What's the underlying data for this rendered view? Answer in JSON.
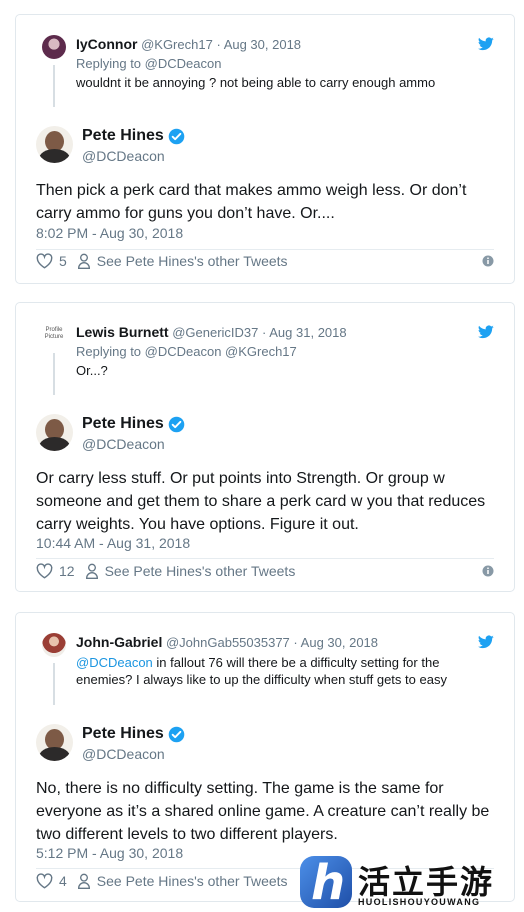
{
  "tweets": [
    {
      "reply": {
        "name": "IyConnor",
        "handle": "@KGrech17",
        "date": "Aug 30, 2018",
        "replying_to": "Replying to @DCDeacon",
        "text": "wouldnt it be annoying ? not being able to carry enough ammo"
      },
      "author": {
        "name": "Pete Hines",
        "handle": "@DCDeacon"
      },
      "text": "Then pick a perk card that makes ammo weigh less. Or don’t carry ammo for guns you don’t have. Or....",
      "timestamp": "8:02 PM - Aug 30, 2018",
      "likes": "5",
      "see_other": "See Pete Hines's other Tweets"
    },
    {
      "reply": {
        "name": "Lewis Burnett",
        "handle": "@GenericID37",
        "date": "Aug 31, 2018",
        "replying_to": "Replying to @DCDeacon @KGrech17",
        "text": "Or...?",
        "avatar_placeholder": "Profile Picture"
      },
      "author": {
        "name": "Pete Hines",
        "handle": "@DCDeacon"
      },
      "text": "Or carry less stuff. Or put points into Strength. Or group w someone and get them to share a perk card w you that reduces carry weights. You have options. Figure it out.",
      "timestamp": "10:44 AM - Aug 31, 2018",
      "likes": "12",
      "see_other": "See Pete Hines's other Tweets"
    },
    {
      "reply": {
        "name": "John-Gabriel",
        "handle": "@JohnGab55035377",
        "date": "Aug 30, 2018",
        "mention": "@DCDeacon",
        "text": " in fallout 76 will there be a difficulty setting for the enemies? I always like to up the difficulty when stuff gets to easy"
      },
      "author": {
        "name": "Pete Hines",
        "handle": "@DCDeacon"
      },
      "text": "No, there is no difficulty setting. The game is the same for everyone as it’s a shared online game. A creature can’t really be two different levels to two different players.",
      "timestamp": "5:12 PM - Aug 30, 2018",
      "likes": "4",
      "see_other": "See Pete Hines's other Tweets"
    }
  ],
  "separator": "·",
  "watermark": {
    "chinese": "活立手游网",
    "latin": "HUOLISHOUYOUWANG"
  },
  "colors": {
    "twitter_blue": "#1da1f2",
    "link": "#1b95e0",
    "muted": "#657786"
  }
}
